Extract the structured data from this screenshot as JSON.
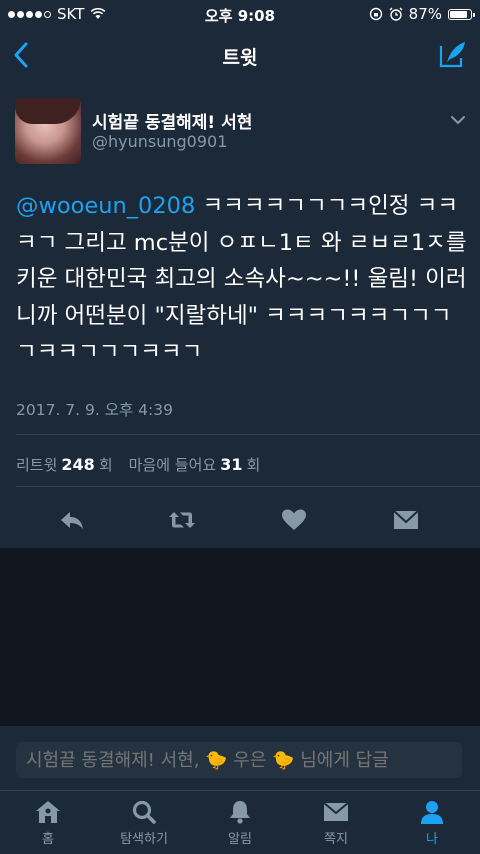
{
  "status_bar": {
    "carrier": "SKT",
    "time": "오후 9:08",
    "battery": "87%",
    "battery_level": 0.87
  },
  "nav": {
    "title": "트윗"
  },
  "tweet": {
    "display_name": "시험끝 동결해제! 서현",
    "handle": "@hyunsung0901",
    "mention": "@wooeun_0208",
    "text_after_mention": " ㅋㅋㅋㅋㄱㄱㄱㅋ인정 ㅋㅋㅋㄱ 그리고 mc분이 ㅇㅍㄴ1ㅌ 와 ㄹㅂㄹ1ㅈ를 키운 대한민국 최고의 소속사~~~!! 울림! 이러니까 어떤분이 \"지랄하네\" ㅋㅋㅋㄱㅋㅋㄱㄱㄱㄱㅋㅋㄱㄱㄱㅋㅋㄱ",
    "timestamp": "2017. 7. 9. 오후 4:39",
    "retweet_label": "리트윗",
    "retweet_count": "248",
    "retweet_unit": "회",
    "like_label": "마음에 들어요",
    "like_count": "31",
    "like_unit": "회"
  },
  "reply": {
    "placeholder": "시험끝 동결해제! 서현, 🐤 우은 🐤 님에게 답글"
  },
  "tabs": [
    {
      "label": "홈",
      "icon": "home-icon"
    },
    {
      "label": "탐색하기",
      "icon": "search-icon"
    },
    {
      "label": "알림",
      "icon": "bell-icon"
    },
    {
      "label": "쪽지",
      "icon": "envelope-icon"
    },
    {
      "label": "나",
      "icon": "person-icon"
    }
  ],
  "colors": {
    "accent": "#1da1f2",
    "card": "#1c2938",
    "background": "#10171e",
    "muted": "#8899a6"
  }
}
